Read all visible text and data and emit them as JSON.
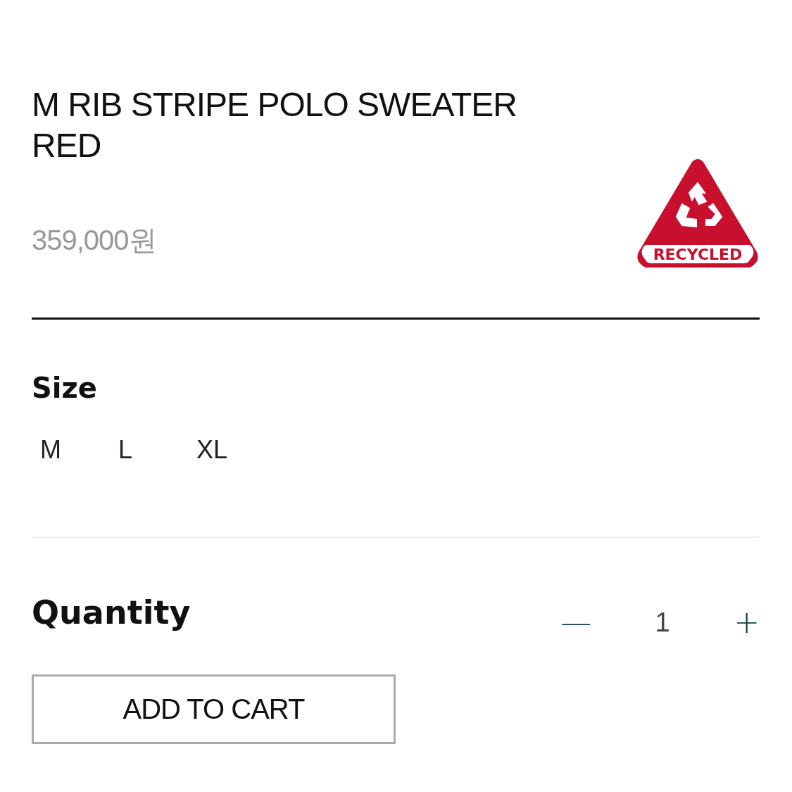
{
  "product": {
    "title_lines": [
      "M RIB STRIPE POLO SWEATER",
      "RED"
    ],
    "price": "359,000원",
    "badge": {
      "label": "RECYCLED"
    }
  },
  "size": {
    "label": "Size",
    "options": [
      "M",
      "L",
      "XL"
    ]
  },
  "quantity": {
    "label": "Quantity",
    "decrease": "—",
    "value": "1",
    "increase": "+"
  },
  "add_to_cart": "ADD TO CART"
}
